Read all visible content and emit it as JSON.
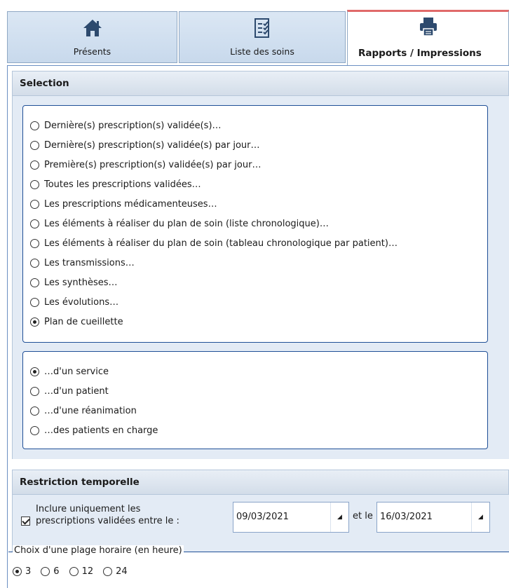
{
  "tabs": [
    {
      "label": "Présents",
      "icon": "home-icon"
    },
    {
      "label": "Liste des soins",
      "icon": "checklist-icon"
    },
    {
      "label": "Rapports / Impressions",
      "icon": "printer-icon",
      "active": true
    }
  ],
  "selection": {
    "title": "Selection",
    "report_options": [
      {
        "label": "Dernière(s) prescription(s) validée(s)…",
        "checked": false
      },
      {
        "label": "Dernière(s) prescription(s) validée(s) par jour…",
        "checked": false
      },
      {
        "label": "Première(s) prescription(s) validée(s) par jour…",
        "checked": false
      },
      {
        "label": "Toutes les prescriptions validées…",
        "checked": false
      },
      {
        "label": "Les prescriptions médicamenteuses…",
        "checked": false
      },
      {
        "label": "Les éléments à réaliser du plan de soin (liste chronologique)…",
        "checked": false
      },
      {
        "label": "Les éléments à réaliser du plan de soin (tableau chronologique par patient)…",
        "checked": false
      },
      {
        "label": "Les transmissions…",
        "checked": false
      },
      {
        "label": "Les synthèses…",
        "checked": false
      },
      {
        "label": "Les évolutions…",
        "checked": false
      },
      {
        "label": "Plan de cueillette",
        "checked": true
      }
    ],
    "scope_options": [
      {
        "label": "…d'un service",
        "checked": true
      },
      {
        "label": "…d'un patient",
        "checked": false
      },
      {
        "label": "…d'une réanimation",
        "checked": false
      },
      {
        "label": "…des patients en charge",
        "checked": false
      }
    ]
  },
  "restriction": {
    "title": "Restriction temporelle",
    "include_label_line1": "Inclure uniquement les",
    "include_label_line2": "prescriptions validées entre le :",
    "include_checked": true,
    "date_from": "09/03/2021",
    "between_label": "et le",
    "date_to": "16/03/2021",
    "hour_range_legend": "Choix d'une plage horaire (en heure)",
    "hour_options": [
      {
        "label": "3",
        "checked": true
      },
      {
        "label": "6",
        "checked": false
      },
      {
        "label": "12",
        "checked": false
      },
      {
        "label": "24",
        "checked": false
      }
    ]
  }
}
